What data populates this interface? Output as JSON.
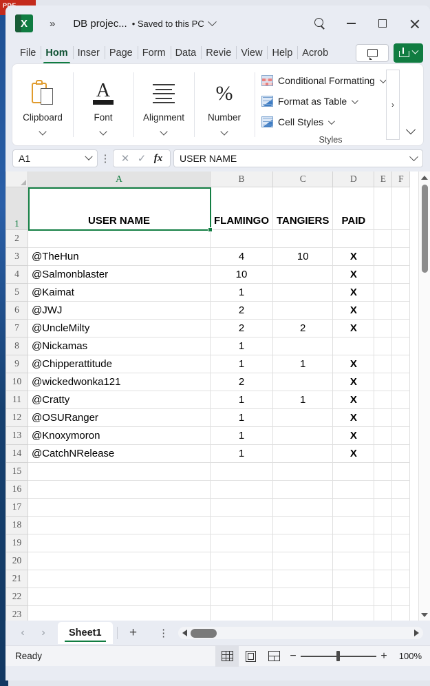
{
  "titlebar": {
    "app_icon": "excel-logo",
    "overflow_label": "»",
    "document_title": "DB projec...",
    "save_status": "• Saved to this PC",
    "search_icon": "search-icon",
    "minimize_icon": "minimize-icon",
    "maximize_icon": "maximize-icon",
    "close_icon": "close-icon"
  },
  "ribbon_tabs": [
    {
      "label": "File",
      "active": false
    },
    {
      "label": "Hom",
      "active": true
    },
    {
      "label": "Inser",
      "active": false
    },
    {
      "label": "Page",
      "active": false
    },
    {
      "label": "Form",
      "active": false
    },
    {
      "label": "Data",
      "active": false
    },
    {
      "label": "Revie",
      "active": false
    },
    {
      "label": "View",
      "active": false
    },
    {
      "label": "Help",
      "active": false
    },
    {
      "label": "Acrob",
      "active": false
    }
  ],
  "ribbon_actions": {
    "comment_label": "comment-icon",
    "share_label": "share-icon"
  },
  "ribbon": {
    "groups": [
      {
        "label": "Clipboard",
        "icon": "clipboard-icon"
      },
      {
        "label": "Font",
        "icon": "font-icon"
      },
      {
        "label": "Alignment",
        "icon": "alignment-icon"
      },
      {
        "label": "Number",
        "icon": "percent-icon"
      }
    ],
    "styles": {
      "caption": "Styles",
      "items": [
        {
          "label": "Conditional Formatting",
          "icon": "conditional-formatting-icon"
        },
        {
          "label": "Format as Table",
          "icon": "format-as-table-icon"
        },
        {
          "label": "Cell Styles",
          "icon": "cell-styles-icon"
        }
      ]
    },
    "scroll_right_label": "›",
    "collapse_icon": "chevron-down-icon"
  },
  "formula_bar": {
    "name_box_value": "A1",
    "cancel_icon": "✕",
    "enter_icon": "✓",
    "function_icon": "fx",
    "formula_value": "USER NAME"
  },
  "grid": {
    "columns": [
      "A",
      "B",
      "C",
      "D",
      "E",
      "F"
    ],
    "selected_cell": "A1",
    "rows": [
      {
        "n": "1",
        "a": "USER NAME",
        "b": "FLAMINGO",
        "c": "TANGIERS",
        "d": "PAID",
        "e": "",
        "f": ""
      },
      {
        "n": "2",
        "a": "",
        "b": "",
        "c": "",
        "d": "",
        "e": "",
        "f": ""
      },
      {
        "n": "3",
        "a": "@TheHun",
        "b": "4",
        "c": "10",
        "d": "X",
        "e": "",
        "f": ""
      },
      {
        "n": "4",
        "a": "@Salmonblaster",
        "b": "10",
        "c": "",
        "d": "X",
        "e": "",
        "f": ""
      },
      {
        "n": "5",
        "a": "@Kaimat",
        "b": "1",
        "c": "",
        "d": "X",
        "e": "",
        "f": ""
      },
      {
        "n": "6",
        "a": "@JWJ",
        "b": "2",
        "c": "",
        "d": "X",
        "e": "",
        "f": ""
      },
      {
        "n": "7",
        "a": "@UncleMilty",
        "b": "2",
        "c": "2",
        "d": "X",
        "e": "",
        "f": ""
      },
      {
        "n": "8",
        "a": "@Nickamas",
        "b": "1",
        "c": "",
        "d": "",
        "e": "",
        "f": ""
      },
      {
        "n": "9",
        "a": "@Chipperattitude",
        "b": "1",
        "c": "1",
        "d": "X",
        "e": "",
        "f": ""
      },
      {
        "n": "10",
        "a": "@wickedwonka121",
        "b": "2",
        "c": "",
        "d": "X",
        "e": "",
        "f": ""
      },
      {
        "n": "11",
        "a": "@Cratty",
        "b": "1",
        "c": "1",
        "d": "X",
        "e": "",
        "f": ""
      },
      {
        "n": "12",
        "a": "@OSURanger",
        "b": "1",
        "c": "",
        "d": "X",
        "e": "",
        "f": ""
      },
      {
        "n": "13",
        "a": "@Knoxymoron",
        "b": "1",
        "c": "",
        "d": "X",
        "e": "",
        "f": ""
      },
      {
        "n": "14",
        "a": "@CatchNRelease",
        "b": "1",
        "c": "",
        "d": "X",
        "e": "",
        "f": ""
      },
      {
        "n": "15",
        "a": "",
        "b": "",
        "c": "",
        "d": "",
        "e": "",
        "f": ""
      },
      {
        "n": "16",
        "a": "",
        "b": "",
        "c": "",
        "d": "",
        "e": "",
        "f": ""
      },
      {
        "n": "17",
        "a": "",
        "b": "",
        "c": "",
        "d": "",
        "e": "",
        "f": ""
      },
      {
        "n": "18",
        "a": "",
        "b": "",
        "c": "",
        "d": "",
        "e": "",
        "f": ""
      },
      {
        "n": "19",
        "a": "",
        "b": "",
        "c": "",
        "d": "",
        "e": "",
        "f": ""
      },
      {
        "n": "20",
        "a": "",
        "b": "",
        "c": "",
        "d": "",
        "e": "",
        "f": ""
      },
      {
        "n": "21",
        "a": "",
        "b": "",
        "c": "",
        "d": "",
        "e": "",
        "f": ""
      },
      {
        "n": "22",
        "a": "",
        "b": "",
        "c": "",
        "d": "",
        "e": "",
        "f": ""
      },
      {
        "n": "23",
        "a": "",
        "b": "",
        "c": "",
        "d": "",
        "e": "",
        "f": ""
      }
    ]
  },
  "sheet_tabs": {
    "prev_icon": "‹",
    "next_icon": "›",
    "tabs": [
      {
        "label": "Sheet1",
        "active": true
      }
    ],
    "add_label": "+",
    "kebab_label": "⋮"
  },
  "statusbar": {
    "status": "Ready",
    "views": [
      {
        "name": "normal-view",
        "active": true
      },
      {
        "name": "page-layout-view",
        "active": false
      },
      {
        "name": "page-break-view",
        "active": false
      }
    ],
    "zoom_out_label": "−",
    "zoom_in_label": "+",
    "zoom_level": "100%"
  },
  "backdrop": {
    "pdf_label": "PDF"
  },
  "colors": {
    "excel_green": "#107c41",
    "selection_green": "#137e43",
    "window_chrome": "#e9ecf3",
    "grid_line": "#e0e0e0",
    "header_gray": "#f1f1f1"
  }
}
